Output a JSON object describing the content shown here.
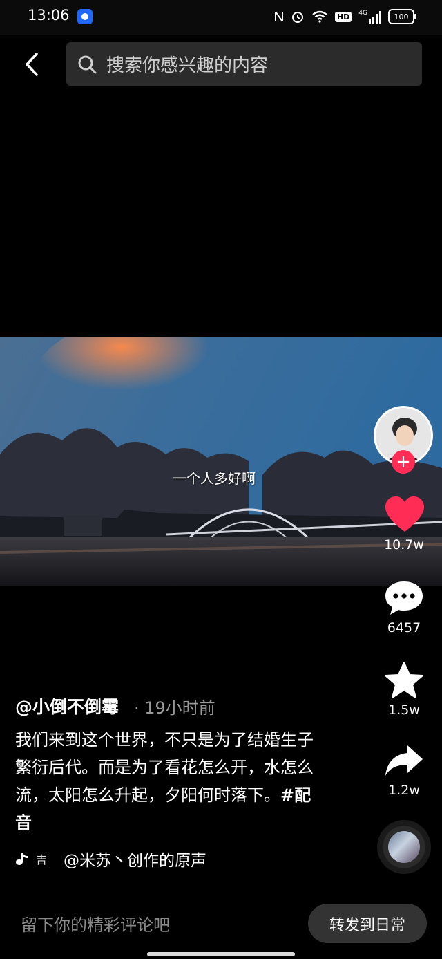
{
  "status_bar": {
    "time": "13:06",
    "icons": [
      "nfc-icon",
      "alarm-icon",
      "wifi-icon",
      "hd-icon",
      "signal-4g-icon",
      "battery-icon"
    ],
    "hd_label": "HD",
    "network_label": "4G",
    "battery": "100"
  },
  "header": {
    "search_placeholder": "搜索你感兴趣的内容"
  },
  "video": {
    "subtitle": "一个人多好啊"
  },
  "actions": {
    "like_count": "10.7w",
    "comment_count": "6457",
    "favorite_count": "1.5w",
    "share_count": "1.2w",
    "follow_symbol": "+"
  },
  "post": {
    "author": "@小倒不倒霉",
    "time_ago": "· 19小时前",
    "caption": "我们来到这个世界，不只是为了结婚生子繁衍后代。而是为了看花怎么开，水怎么流，太阳怎么升起，夕阳何时落下。",
    "hashtag": "#配音",
    "music_mini": "吉",
    "music": "@米苏丶创作的原声"
  },
  "bottom_bar": {
    "comment_placeholder": "留下你的精彩评论吧",
    "repost_label": "转发到日常"
  },
  "colors": {
    "accent_red": "#ff2d55",
    "search_bg": "#2b2b2b",
    "repost_bg": "#333333"
  }
}
